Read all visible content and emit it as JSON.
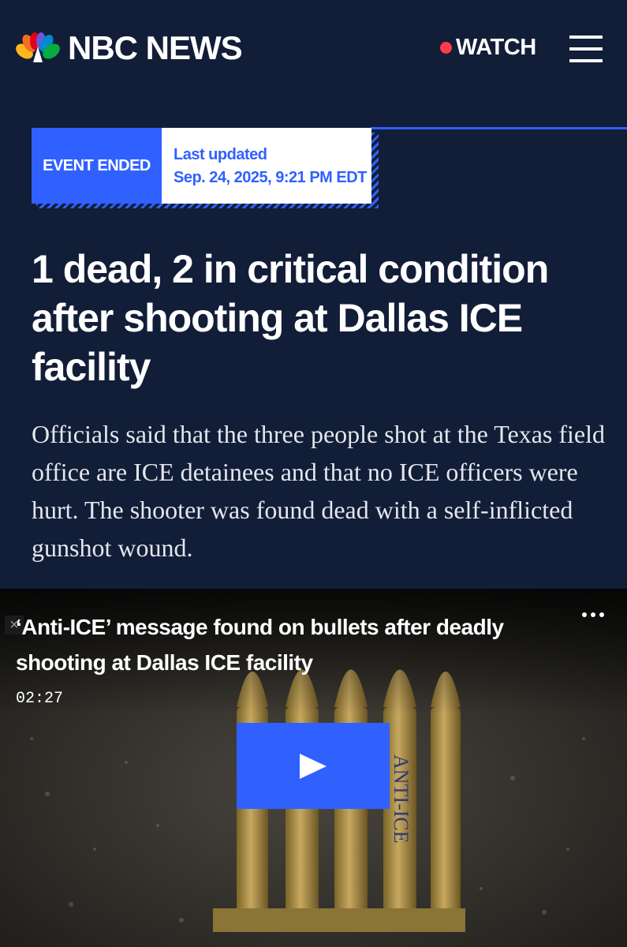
{
  "header": {
    "brand": "NBC NEWS",
    "watch_label": "WATCH",
    "live_dot_color": "#ff3b4a",
    "menu_icon": "hamburger-menu-icon",
    "background_color": "#121e38"
  },
  "status": {
    "badge": "EVENT ENDED",
    "updated_label": "Last updated",
    "updated_time": "Sep. 24, 2025, 9:21 PM EDT",
    "accent_color": "#3061ff"
  },
  "article": {
    "headline": "1 dead, 2 in critical condition after shooting at Dallas ICE facility",
    "dek": "Officials said that the three people shot at the Texas field office are ICE detainees and that no ICE officers were hurt. The shooter was found dead with a self-inflicted gunshot wound."
  },
  "video": {
    "title": "‘Anti-ICE’ message found on bullets after deadly shooting at Dallas ICE facility",
    "duration": "02:27",
    "more_icon": "more-options-icon",
    "play_icon": "play-icon",
    "close_icon": "close-icon",
    "close_glyph": "×",
    "bullet_inscription": "ANTI-ICE"
  }
}
